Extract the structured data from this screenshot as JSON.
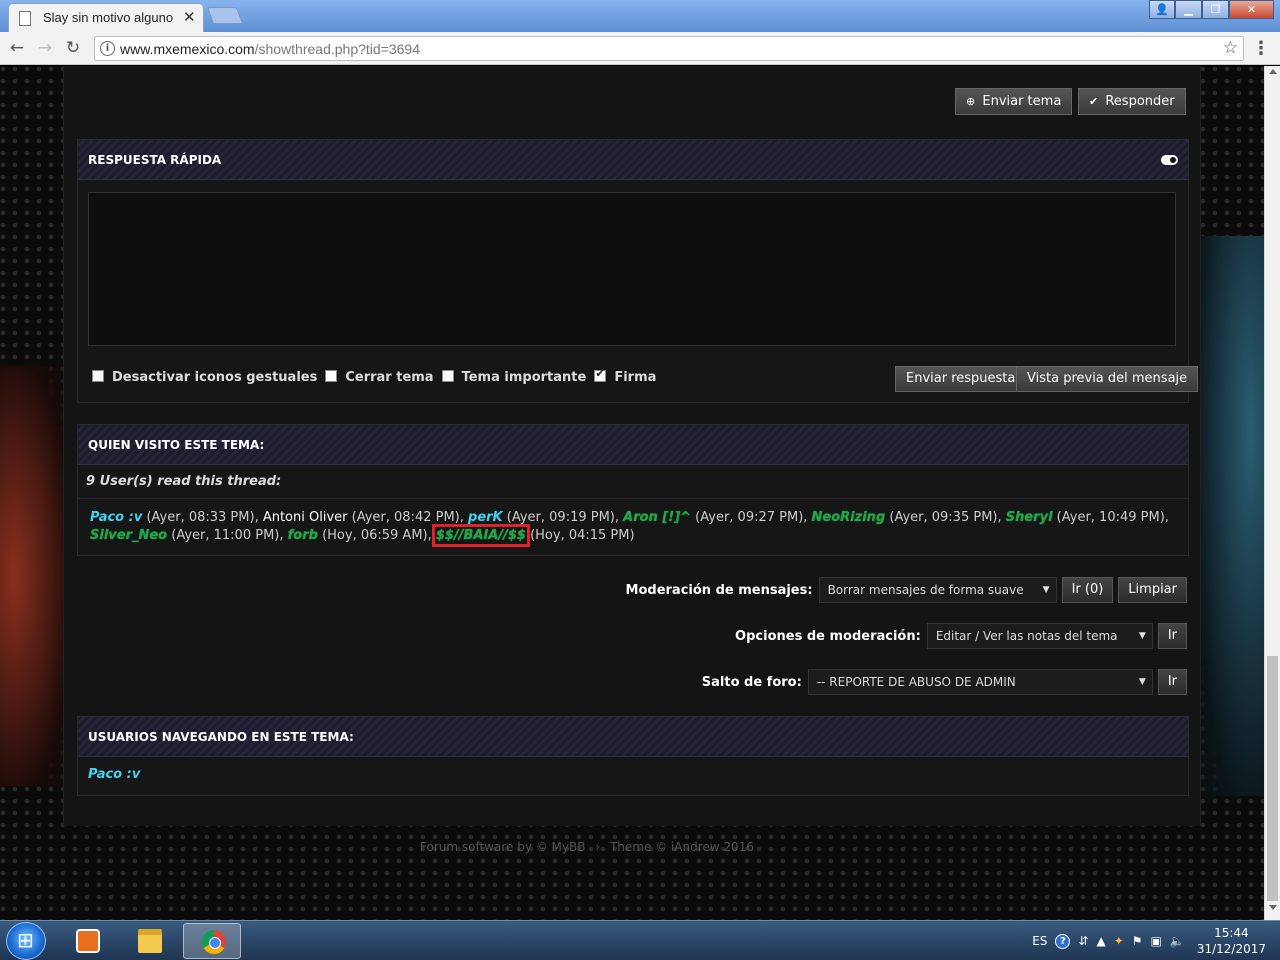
{
  "browser": {
    "tab_title": "Slay sin motivo alguno",
    "url_domain": "www.mxemexico.com",
    "url_path": "/showthread.php?tid=3694"
  },
  "thread_buttons": {
    "new_thread": "Enviar tema",
    "reply": "Responder"
  },
  "quick_reply": {
    "title": "RESPUESTA RÁPIDA",
    "options": [
      {
        "label": "Desactivar iconos gestuales",
        "checked": false
      },
      {
        "label": "Cerrar tema",
        "checked": false
      },
      {
        "label": "Tema importante",
        "checked": false
      },
      {
        "label": "Firma",
        "checked": true
      }
    ],
    "submit": "Enviar respuesta",
    "preview": "Vista previa del mensaje"
  },
  "who_visited": {
    "title": "QUIEN VISITO ESTE TEMA:",
    "count_text": "9 User(s) read this thread:",
    "visitors": [
      {
        "name": "Paco :v",
        "time": "(Ayer, 08:33 PM)",
        "style": "cyan"
      },
      {
        "name": "Antoni Oliver",
        "time": "(Ayer, 08:42 PM)",
        "style": "white"
      },
      {
        "name": "perK",
        "time": "(Ayer, 09:19 PM)",
        "style": "cyan"
      },
      {
        "name": "Aron [!]^",
        "time": "(Ayer, 09:27 PM)",
        "style": "green"
      },
      {
        "name": "NeoRizing",
        "time": "(Ayer, 09:35 PM)",
        "style": "green"
      },
      {
        "name": "Sheryl",
        "time": "(Ayer, 10:49 PM)",
        "style": "green"
      },
      {
        "name": "Silver_Neo",
        "time": "(Ayer, 11:00 PM)",
        "style": "green"
      },
      {
        "name": "forb",
        "time": "(Hoy, 06:59 AM)",
        "style": "green"
      },
      {
        "name": "$$//BAIA//$$",
        "time": "(Hoy, 04:15 PM)",
        "style": "green",
        "highlighted": true
      }
    ]
  },
  "moderation": {
    "messages_label": "Moderación de mensajes:",
    "messages_select": "Borrar mensajes de forma suave",
    "messages_go": "Ir (0)",
    "messages_clear": "Limpiar",
    "options_label": "Opciones de moderación:",
    "options_select": "Editar / Ver las notas del tema",
    "options_go": "Ir",
    "jump_label": "Salto de foro:",
    "jump_select": "-- REPORTE DE ABUSO DE ADMIN",
    "jump_go": "Ir"
  },
  "browsing": {
    "title": "USUARIOS NAVEGANDO EN ESTE TEMA:",
    "user": "Paco :v"
  },
  "footer": {
    "software": "Forum software by © MyBB",
    "separator": "›",
    "theme": "Theme © iAndrew 2016"
  },
  "taskbar": {
    "lang": "ES",
    "time": "15:44",
    "date": "31/12/2017"
  }
}
